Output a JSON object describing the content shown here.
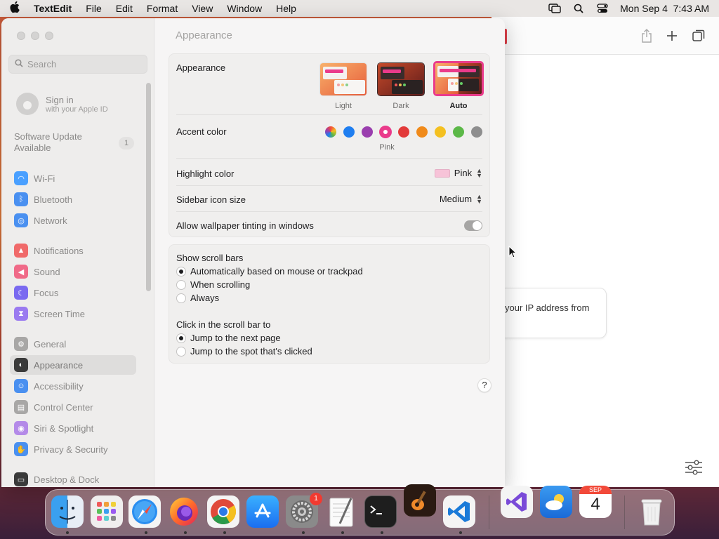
{
  "menubar": {
    "app_name": "TextEdit",
    "items": [
      "File",
      "Edit",
      "Format",
      "View",
      "Window",
      "Help"
    ],
    "clock": "Mon Sep 4  7:43 AM"
  },
  "browser_bg": {
    "card_text": "your IP address from"
  },
  "settings": {
    "search_placeholder": "Search",
    "signin": {
      "title": "Sign in",
      "subtitle": "with your Apple ID"
    },
    "software_update": {
      "label": "Software Update Available",
      "badge": "1"
    },
    "sidebar_items": [
      {
        "label": "Wi-Fi",
        "color": "#4aa0ff",
        "icon": "wifi-icon",
        "glyph": "◠"
      },
      {
        "label": "Bluetooth",
        "color": "#4a90f0",
        "icon": "bluetooth-icon",
        "glyph": "ᛒ"
      },
      {
        "label": "Network",
        "color": "#4a90f0",
        "icon": "globe-icon",
        "glyph": "◎"
      },
      {
        "label": "Notifications",
        "color": "#f06a6a",
        "icon": "bell-icon",
        "glyph": "▲"
      },
      {
        "label": "Sound",
        "color": "#f06a88",
        "icon": "speaker-icon",
        "glyph": "◀"
      },
      {
        "label": "Focus",
        "color": "#7a6af0",
        "icon": "moon-icon",
        "glyph": "☾"
      },
      {
        "label": "Screen Time",
        "color": "#9a7af0",
        "icon": "hourglass-icon",
        "glyph": "⧗"
      },
      {
        "label": "General",
        "color": "#a8a7a6",
        "icon": "gear-icon",
        "glyph": "⚙"
      },
      {
        "label": "Appearance",
        "color": "#3a3a3a",
        "icon": "appearance-icon",
        "glyph": "◐"
      },
      {
        "label": "Accessibility",
        "color": "#4a90f0",
        "icon": "accessibility-icon",
        "glyph": "☺"
      },
      {
        "label": "Control Center",
        "color": "#a8a7a6",
        "icon": "control-center-icon",
        "glyph": "▤"
      },
      {
        "label": "Siri & Spotlight",
        "color": "#b48ae8",
        "icon": "siri-icon",
        "glyph": "◉"
      },
      {
        "label": "Privacy & Security",
        "color": "#4a90f0",
        "icon": "hand-icon",
        "glyph": "✋"
      },
      {
        "label": "Desktop & Dock",
        "color": "#3a3a3a",
        "icon": "dock-icon",
        "glyph": "▭"
      }
    ],
    "main": {
      "title": "Appearance",
      "appearance_label": "Appearance",
      "modes": [
        {
          "label": "Light",
          "selected": false
        },
        {
          "label": "Dark",
          "selected": false
        },
        {
          "label": "Auto",
          "selected": true
        }
      ],
      "accent_label": "Accent color",
      "accent_colors": [
        "multicolor",
        "#1f7ef0",
        "#9a3eae",
        "#ea3b8b",
        "#e23a3a",
        "#f08a1a",
        "#f4c020",
        "#5cb848",
        "#8e8e8e"
      ],
      "accent_selected_name": "Pink",
      "highlight_label": "Highlight color",
      "highlight_value": "Pink",
      "sidebar_icon_label": "Sidebar icon size",
      "sidebar_icon_value": "Medium",
      "tinting_label": "Allow wallpaper tinting in windows",
      "tinting_on": true,
      "scroll_label": "Show scroll bars",
      "scroll_options": [
        "Automatically based on mouse or trackpad",
        "When scrolling",
        "Always"
      ],
      "scroll_selected": 0,
      "click_label": "Click in the scroll bar to",
      "click_options": [
        "Jump to the next page",
        "Jump to the spot that's clicked"
      ],
      "click_selected": 0,
      "help": "?"
    }
  },
  "dock": {
    "calendar_month": "SEP",
    "calendar_day": "4",
    "settings_badge": "1"
  }
}
